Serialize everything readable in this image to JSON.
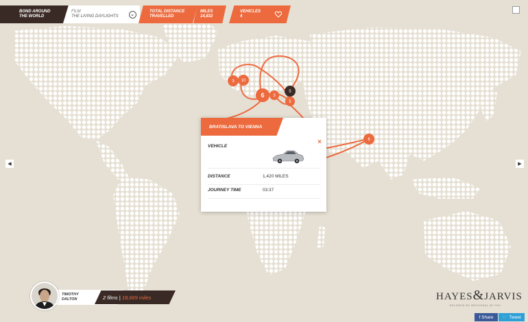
{
  "header": {
    "title_line1": "Bond around",
    "title_line2": "the world",
    "film_label": "Film",
    "film_name": "The Living Daylights",
    "total_distance_line1": "Total distance",
    "total_distance_line2": "travelled",
    "miles_label": "Miles",
    "miles_value": "14,832",
    "vehicles_label": "Vehicles",
    "vehicles_value": "4"
  },
  "map_markers": [
    "3",
    "10",
    "6",
    "3",
    "5",
    "5",
    "6"
  ],
  "popup": {
    "title": "BRATISLAVA TO VIENNA",
    "vehicle_label": "VEHICLE",
    "distance_label": "DISTANCE",
    "distance_value": "1,420 MILES",
    "time_label": "JOURNEY TIME",
    "time_value": "03:37",
    "close_symbol": "×"
  },
  "profile": {
    "first_name": "TIMOTHY",
    "last_name": "DALTON",
    "films": "2 films",
    "separator": "|",
    "miles": "18,669 miles"
  },
  "logo": {
    "left": "HAYES",
    "amp": "&",
    "right": "JARVIS",
    "tagline": "HOLIDAYS AS INDIVIDUAL AS YOU"
  },
  "share": {
    "facebook": "f Share",
    "twitter": "Tweet"
  },
  "colors": {
    "accent": "#ec6a3d",
    "dark": "#3a2a25",
    "background": "#e6e0d4",
    "land_dots": "#ffffff"
  }
}
